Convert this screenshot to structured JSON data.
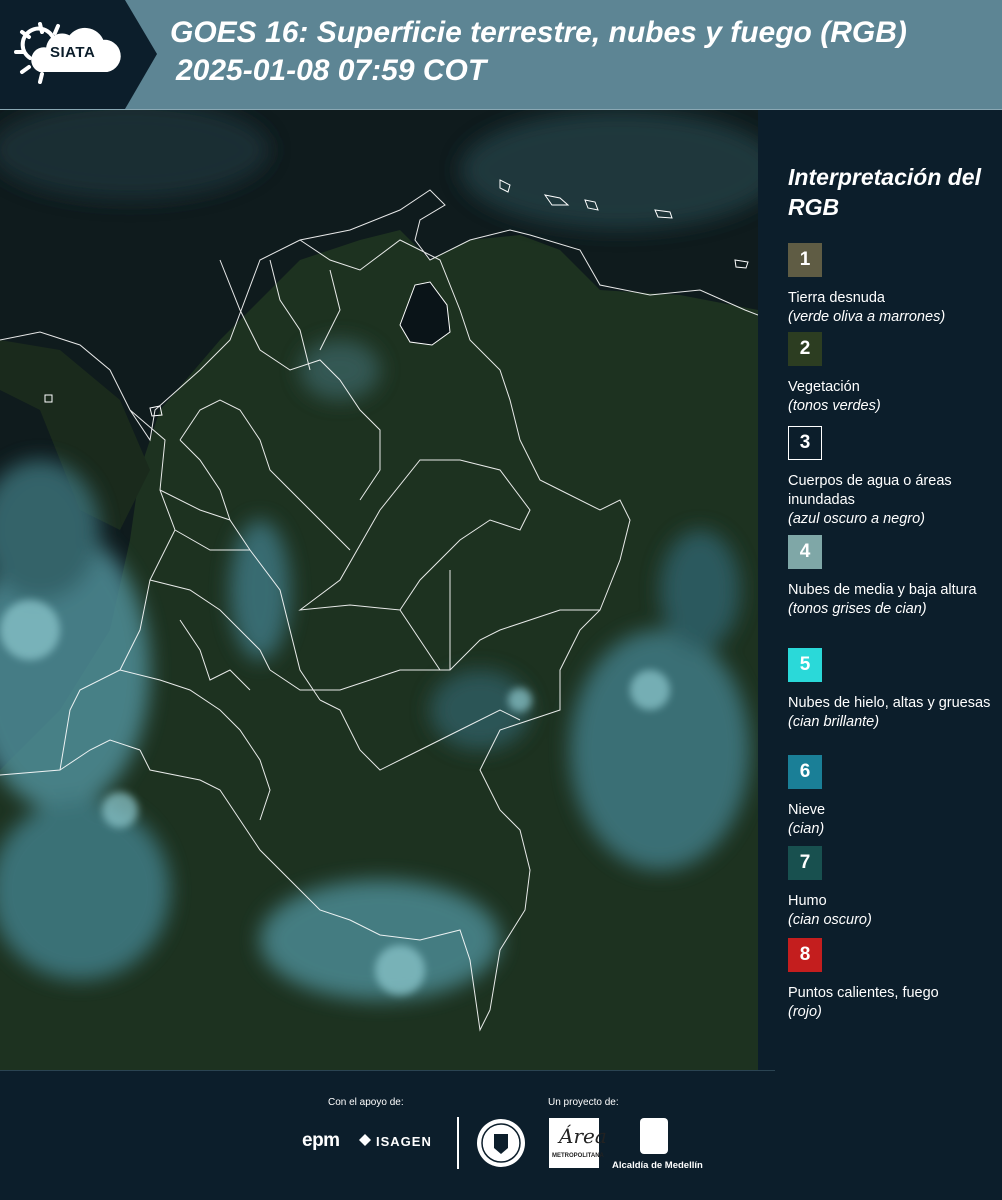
{
  "header": {
    "logo_text": "SIATA",
    "title_line1": "GOES 16: Superficie terrestre, nubes y fuego (RGB)",
    "title_line2": "2025-01-08 07:59 COT"
  },
  "legend": {
    "title": "Interpretación del RGB",
    "items": [
      {
        "number": "1",
        "label": "Tierra desnuda",
        "sub": "(verde oliva a marrones)",
        "color": "#5f5c44"
      },
      {
        "number": "2",
        "label": "Vegetación",
        "sub": "(tonos verdes)",
        "color": "#2c3d21"
      },
      {
        "number": "3",
        "label": "Cuerpos de agua o áreas inundadas",
        "sub": "(azul oscuro a negro)",
        "color": "#0c1e2b"
      },
      {
        "number": "4",
        "label": "Nubes de media y baja altura",
        "sub": "(tonos grises de cian)",
        "color": "#7fa7a7"
      },
      {
        "number": "5",
        "label": "Nubes de hielo, altas y gruesas",
        "sub": "(cian brillante)",
        "color": "#2ad9d9"
      },
      {
        "number": "6",
        "label": "Nieve",
        "sub": "(cian)",
        "color": "#1a7f97"
      },
      {
        "number": "7",
        "label": "Humo",
        "sub": "(cian oscuro)",
        "color": "#18504f"
      },
      {
        "number": "8",
        "label": "Puntos calientes, fuego",
        "sub": "(rojo)",
        "color": "#c41e1e"
      }
    ]
  },
  "footer": {
    "support_label": "Con el apoyo de:",
    "project_label": "Un proyecto de:",
    "epm": "epm",
    "isagen": "ISAGEN",
    "area_logo_text": "Área",
    "area_sub": "METROPOLITANA",
    "alcaldia": "Alcaldía de Medellín"
  },
  "colors": {
    "header_bg": "#5d8594",
    "page_bg": "#0c1e2b",
    "vegetation": "#1d3220",
    "cloud": "#6fb4bf",
    "border_lines": "#ffffff"
  }
}
